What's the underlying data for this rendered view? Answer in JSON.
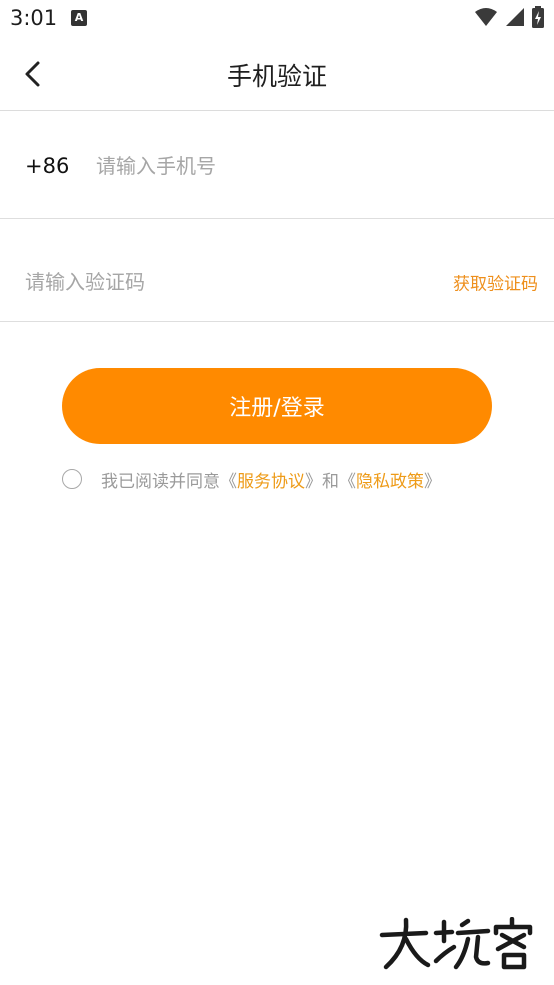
{
  "status_bar": {
    "time": "3:01",
    "notification_letter": "A"
  },
  "header": {
    "title": "手机验证"
  },
  "phone": {
    "country_code": "+86",
    "placeholder": "请输入手机号"
  },
  "code": {
    "placeholder": "请输入验证码",
    "get_code_label": "获取验证码"
  },
  "submit": {
    "label": "注册/登录"
  },
  "agreement": {
    "prefix": "我已阅读并同意《",
    "service_link": "服务协议",
    "middle": "》和《",
    "privacy_link": "隐私政策",
    "suffix": "》",
    "checked": false
  },
  "watermark": {
    "text": "大玩客"
  },
  "colors": {
    "accent": "#ff8a00",
    "link": "#ee9b18"
  },
  "icons": [
    "back-arrow-icon",
    "wifi-icon",
    "signal-icon",
    "battery-icon",
    "radio-unchecked-icon"
  ]
}
